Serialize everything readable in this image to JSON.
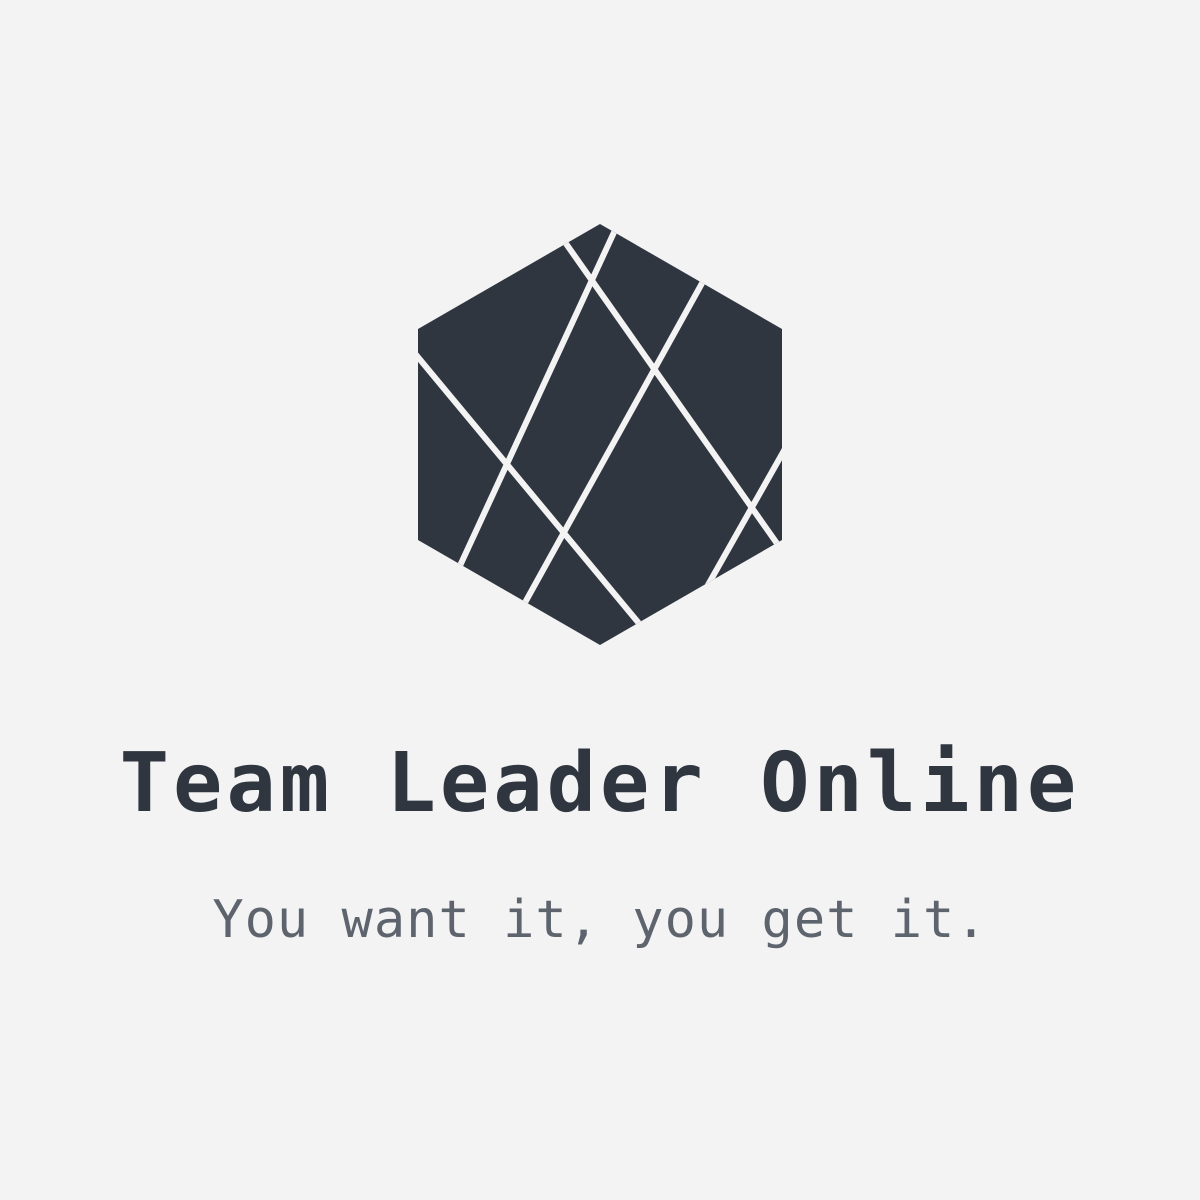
{
  "brand": {
    "name": "Team Leader Online",
    "tagline": "You want it, you get it."
  },
  "logo": {
    "icon": "faceted-hexagon-icon"
  },
  "colors": {
    "background": "#f3f3f3",
    "mark": "#2f3640",
    "brand_text": "#2f3640",
    "tagline_text": "#5e646d",
    "facet_lines": "#f3f3f3"
  }
}
